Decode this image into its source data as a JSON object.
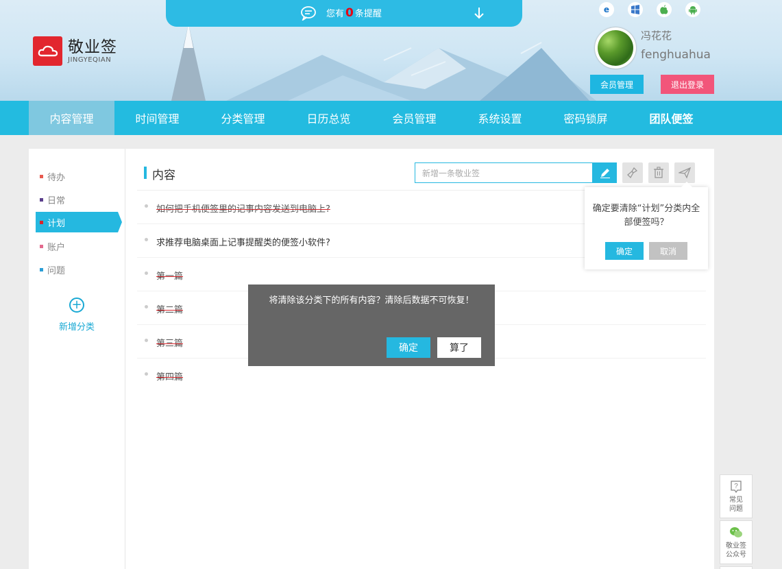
{
  "brand": {
    "name_cn": "敬业签",
    "name_en": "JINGYEQIAN"
  },
  "notice": {
    "prefix": "您有",
    "count": "0",
    "suffix": "条提醒"
  },
  "platforms": [
    "ie-icon",
    "windows-icon",
    "apple-icon",
    "android-icon"
  ],
  "user": {
    "name": "冯花花",
    "id": "fenghuahua",
    "member_btn": "会员管理",
    "logout_btn": "退出登录"
  },
  "nav": [
    "内容管理",
    "时间管理",
    "分类管理",
    "日历总览",
    "会员管理",
    "系统设置",
    "密码锁屏",
    "团队便签"
  ],
  "categories": [
    {
      "label": "待办",
      "color": "#e85a4f"
    },
    {
      "label": "日常",
      "color": "#5b3f8c"
    },
    {
      "label": "计划",
      "color": "#d9252b"
    },
    {
      "label": "账户",
      "color": "#e36a8e"
    },
    {
      "label": "问题",
      "color": "#2a9ed6"
    }
  ],
  "add_category": "新增分类",
  "content": {
    "title": "内容",
    "search_placeholder": "新增一条敬业签",
    "notes": [
      {
        "text": "如何把手机便签里的记事内容发送到电脑上?",
        "done": true
      },
      {
        "text": "求推荐电脑桌面上记事提醒类的便签小软件?",
        "done": false
      },
      {
        "text": "第一篇",
        "done": true
      },
      {
        "text": "第二篇",
        "done": true
      },
      {
        "text": "第三篇",
        "done": true
      },
      {
        "text": "第四篇",
        "done": true
      }
    ]
  },
  "popover": {
    "message": "确定要清除“计划”分类内全部便签吗？",
    "confirm": "确定",
    "cancel": "取消"
  },
  "dialog": {
    "message": "将清除该分类下的所有内容？清除后数据不可恢复！",
    "confirm": "确定",
    "cancel": "算了"
  },
  "float": {
    "faq": "常见问题",
    "wechat": "敬业签公众号"
  },
  "colors": {
    "accent": "#25b8e0",
    "logout": "#f2557a",
    "brand_red": "#e2262e"
  }
}
